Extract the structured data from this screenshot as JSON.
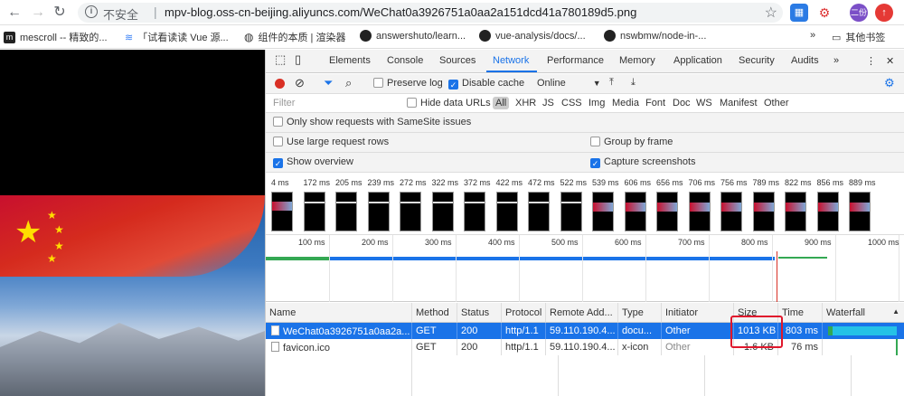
{
  "browser": {
    "security_label": "不安全",
    "url": "mpv-blog.oss-cn-beijing.aliyuncs.com/WeChat0a3926751a0aa2a151dcd41a780189d5.png",
    "ext_avatar": "二份"
  },
  "bookmarks": [
    {
      "label": "mescroll -- 精致的..."
    },
    {
      "label": "「试看读读 Vue 源..."
    },
    {
      "label": "组件的本质 | 渲染器"
    },
    {
      "label": "answershuto/learn..."
    },
    {
      "label": "vue-analysis/docs/..."
    },
    {
      "label": "nswbmw/node-in-..."
    },
    {
      "label": "»"
    },
    {
      "label": "其他书签"
    }
  ],
  "devtools": {
    "tabs": [
      {
        "label": "Elements"
      },
      {
        "label": "Console"
      },
      {
        "label": "Sources"
      },
      {
        "label": "Network"
      },
      {
        "label": "Performance"
      },
      {
        "label": "Memory"
      },
      {
        "label": "Application"
      },
      {
        "label": "Security"
      },
      {
        "label": "Audits"
      }
    ],
    "active_tab": "Network",
    "toolbar": {
      "preserve_log": "Preserve log",
      "disable_cache": "Disable cache",
      "throttle": "Online"
    },
    "filter": {
      "placeholder": "Filter",
      "hide_data_urls": "Hide data URLs",
      "types": [
        "All",
        "XHR",
        "JS",
        "CSS",
        "Img",
        "Media",
        "Font",
        "Doc",
        "WS",
        "Manifest",
        "Other"
      ]
    },
    "options": {
      "samesite": "Only show requests with SameSite issues",
      "large_rows": "Use large request rows",
      "group_by_frame": "Group by frame",
      "show_overview": "Show overview",
      "capture_screenshots": "Capture screenshots"
    },
    "screenshots": [
      "4 ms",
      "172 ms",
      "205 ms",
      "239 ms",
      "272 ms",
      "322 ms",
      "372 ms",
      "422 ms",
      "472 ms",
      "522 ms",
      "539 ms",
      "606 ms",
      "656 ms",
      "706 ms",
      "756 ms",
      "789 ms",
      "822 ms",
      "856 ms",
      "889 ms"
    ],
    "timeline_ticks": [
      "100 ms",
      "200 ms",
      "300 ms",
      "400 ms",
      "500 ms",
      "600 ms",
      "700 ms",
      "800 ms",
      "900 ms",
      "1000 ms"
    ],
    "columns": [
      "Name",
      "Method",
      "Status",
      "Protocol",
      "Remote Add...",
      "Type",
      "Initiator",
      "Size",
      "Time",
      "Waterfall"
    ],
    "requests": [
      {
        "name": "WeChat0a3926751a0aa2a...",
        "method": "GET",
        "status": "200",
        "protocol": "http/1.1",
        "remote": "59.110.190.4...",
        "type": "docu...",
        "initiator": "Other",
        "size": "1013 KB",
        "time": "803 ms",
        "waterfall_fraction": 0.95
      },
      {
        "name": "favicon.ico",
        "method": "GET",
        "status": "200",
        "protocol": "http/1.1",
        "remote": "59.110.190.4...",
        "type": "x-icon",
        "initiator": "Other",
        "size": "1.6 KB",
        "time": "76 ms",
        "waterfall_fraction": 0.0
      }
    ]
  }
}
